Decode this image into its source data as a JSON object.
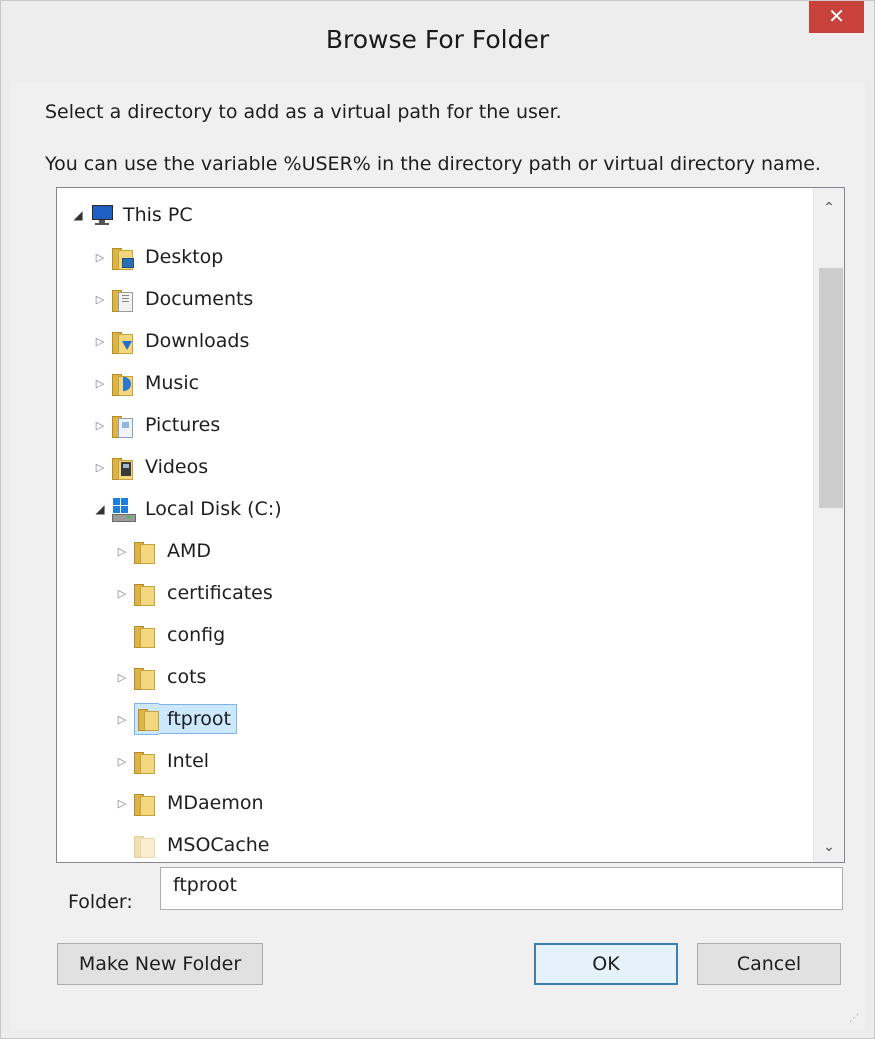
{
  "window": {
    "title": "Browse For Folder",
    "close_glyph": "✕"
  },
  "dialog": {
    "message1": "Select a directory to add as a virtual path for the user.",
    "message2": "You can use the variable %USER% in the directory path or virtual directory name."
  },
  "tree": {
    "items": [
      {
        "label": "This PC",
        "icon": "computer-icon",
        "expander": "open"
      },
      {
        "label": "Desktop",
        "icon": "desktop-folder-icon",
        "expander": "closed"
      },
      {
        "label": "Documents",
        "icon": "documents-folder-icon",
        "expander": "closed"
      },
      {
        "label": "Downloads",
        "icon": "downloads-folder-icon",
        "expander": "closed"
      },
      {
        "label": "Music",
        "icon": "music-folder-icon",
        "expander": "closed"
      },
      {
        "label": "Pictures",
        "icon": "pictures-folder-icon",
        "expander": "closed"
      },
      {
        "label": "Videos",
        "icon": "videos-folder-icon",
        "expander": "closed"
      },
      {
        "label": "Local Disk (C:)",
        "icon": "local-disk-icon",
        "expander": "open"
      },
      {
        "label": "AMD",
        "icon": "folder-icon",
        "expander": "closed"
      },
      {
        "label": "certificates",
        "icon": "folder-icon",
        "expander": "closed"
      },
      {
        "label": "config",
        "icon": "folder-icon",
        "expander": "none"
      },
      {
        "label": "cots",
        "icon": "folder-icon",
        "expander": "closed"
      },
      {
        "label": "ftproot",
        "icon": "folder-icon",
        "expander": "closed",
        "selected": true
      },
      {
        "label": "Intel",
        "icon": "folder-icon",
        "expander": "closed"
      },
      {
        "label": "MDaemon",
        "icon": "folder-icon",
        "expander": "closed"
      },
      {
        "label": "MSOCache",
        "icon": "hidden-folder-icon",
        "expander": "none"
      }
    ],
    "scroll_up_glyph": "⌃",
    "scroll_down_glyph": "⌄"
  },
  "folder_field": {
    "label": "Folder:",
    "value": "ftproot"
  },
  "buttons": {
    "make_new_folder": "Make New Folder",
    "ok": "OK",
    "cancel": "Cancel"
  },
  "colors": {
    "close_button": "#c8413b",
    "selection_background": "#cce8ff",
    "selection_border": "#7eb4ea",
    "default_button_border": "#3c7fb1"
  }
}
